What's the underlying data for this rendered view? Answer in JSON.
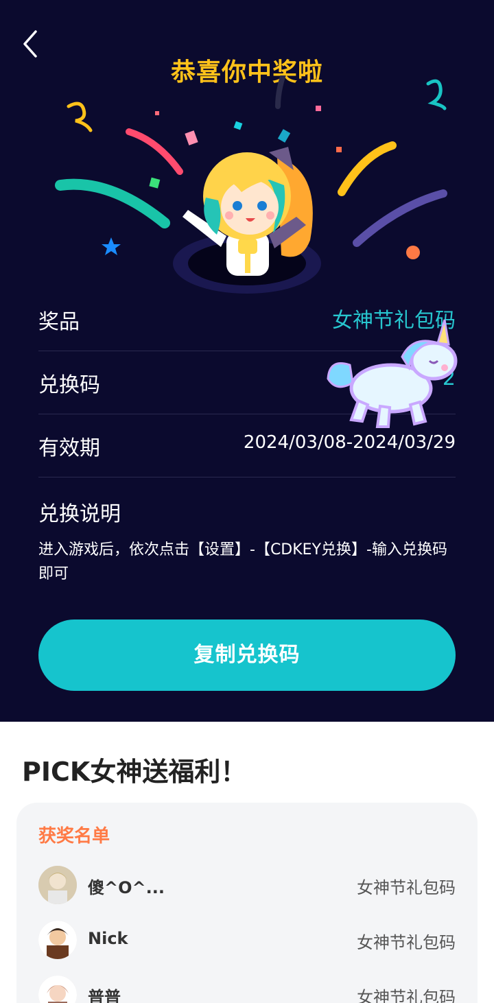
{
  "status": {
    "time_fragment": ""
  },
  "header": {
    "title": "恭喜你中奖啦"
  },
  "prize_info": {
    "prize_label": "奖品",
    "prize_value": "女神节礼包码",
    "code_label": "兑换码",
    "code_value": "2",
    "validity_label": "有效期",
    "validity_value": "2024/03/08-2024/03/29",
    "desc_label": "兑换说明",
    "desc_text": "进入游戏后，依次点击【设置】-【CDKEY兑换】-输入兑换码即可"
  },
  "copy_button": {
    "label": "复制兑换码"
  },
  "section": {
    "title": "PICK女神送福利！"
  },
  "winners": {
    "title": "获奖名单",
    "items": [
      {
        "name": "傻^O^...",
        "prize": "女神节礼包码",
        "avatar": "avatar-1"
      },
      {
        "name": "Nick",
        "prize": "女神节礼包码",
        "avatar": "avatar-2"
      },
      {
        "name": "普普",
        "prize": "女神节礼包码",
        "avatar": "avatar-3"
      }
    ]
  },
  "colors": {
    "background_dark": "#0b0a2e",
    "title_gold": "#ffc21a",
    "accent_teal": "#16c4cd",
    "winners_orange": "#ff7a45"
  },
  "icons": {
    "back": "chevron-left-icon",
    "mascot": "mascot-illustration",
    "unicorn": "unicorn-sticker"
  }
}
